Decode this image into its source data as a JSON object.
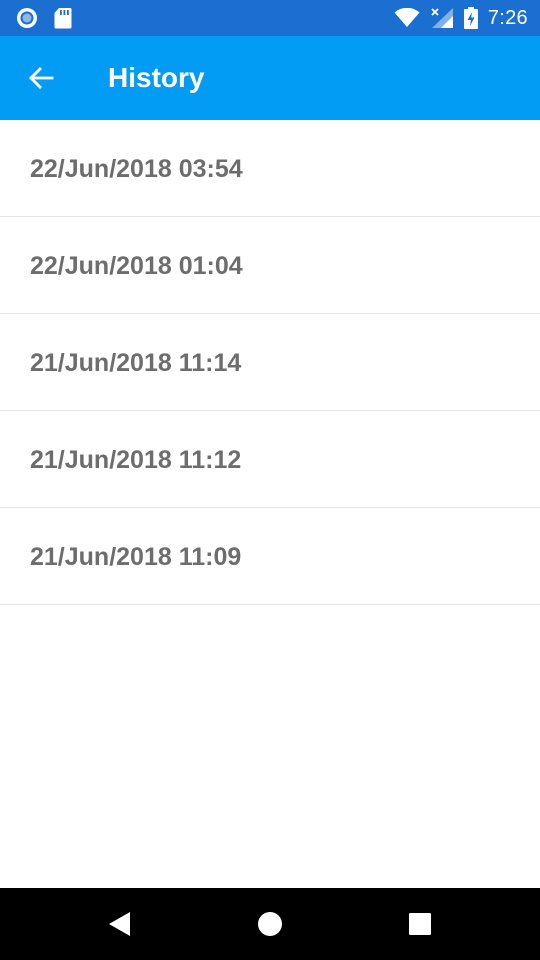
{
  "status_bar": {
    "time": "7:26",
    "left_icons": [
      "record-icon",
      "sd-card-icon"
    ],
    "right_icons": [
      "wifi-icon",
      "cell-signal-icon",
      "battery-charging-icon"
    ]
  },
  "app_bar": {
    "title": "History",
    "back_icon": "arrow-back-icon",
    "background_color": "#039cf4"
  },
  "history": {
    "items": [
      {
        "label": "22/Jun/2018 03:54"
      },
      {
        "label": "22/Jun/2018 01:04"
      },
      {
        "label": "21/Jun/2018 11:14"
      },
      {
        "label": "21/Jun/2018 11:12"
      },
      {
        "label": "21/Jun/2018 11:09"
      }
    ]
  },
  "nav_bar": {
    "buttons": [
      "nav-back-icon",
      "nav-home-icon",
      "nav-recents-icon"
    ]
  },
  "colors": {
    "status_bar": "#1a6fd0",
    "app_bar": "#039cf4",
    "item_text": "#6d6d6d",
    "divider": "#e6e6e6"
  }
}
